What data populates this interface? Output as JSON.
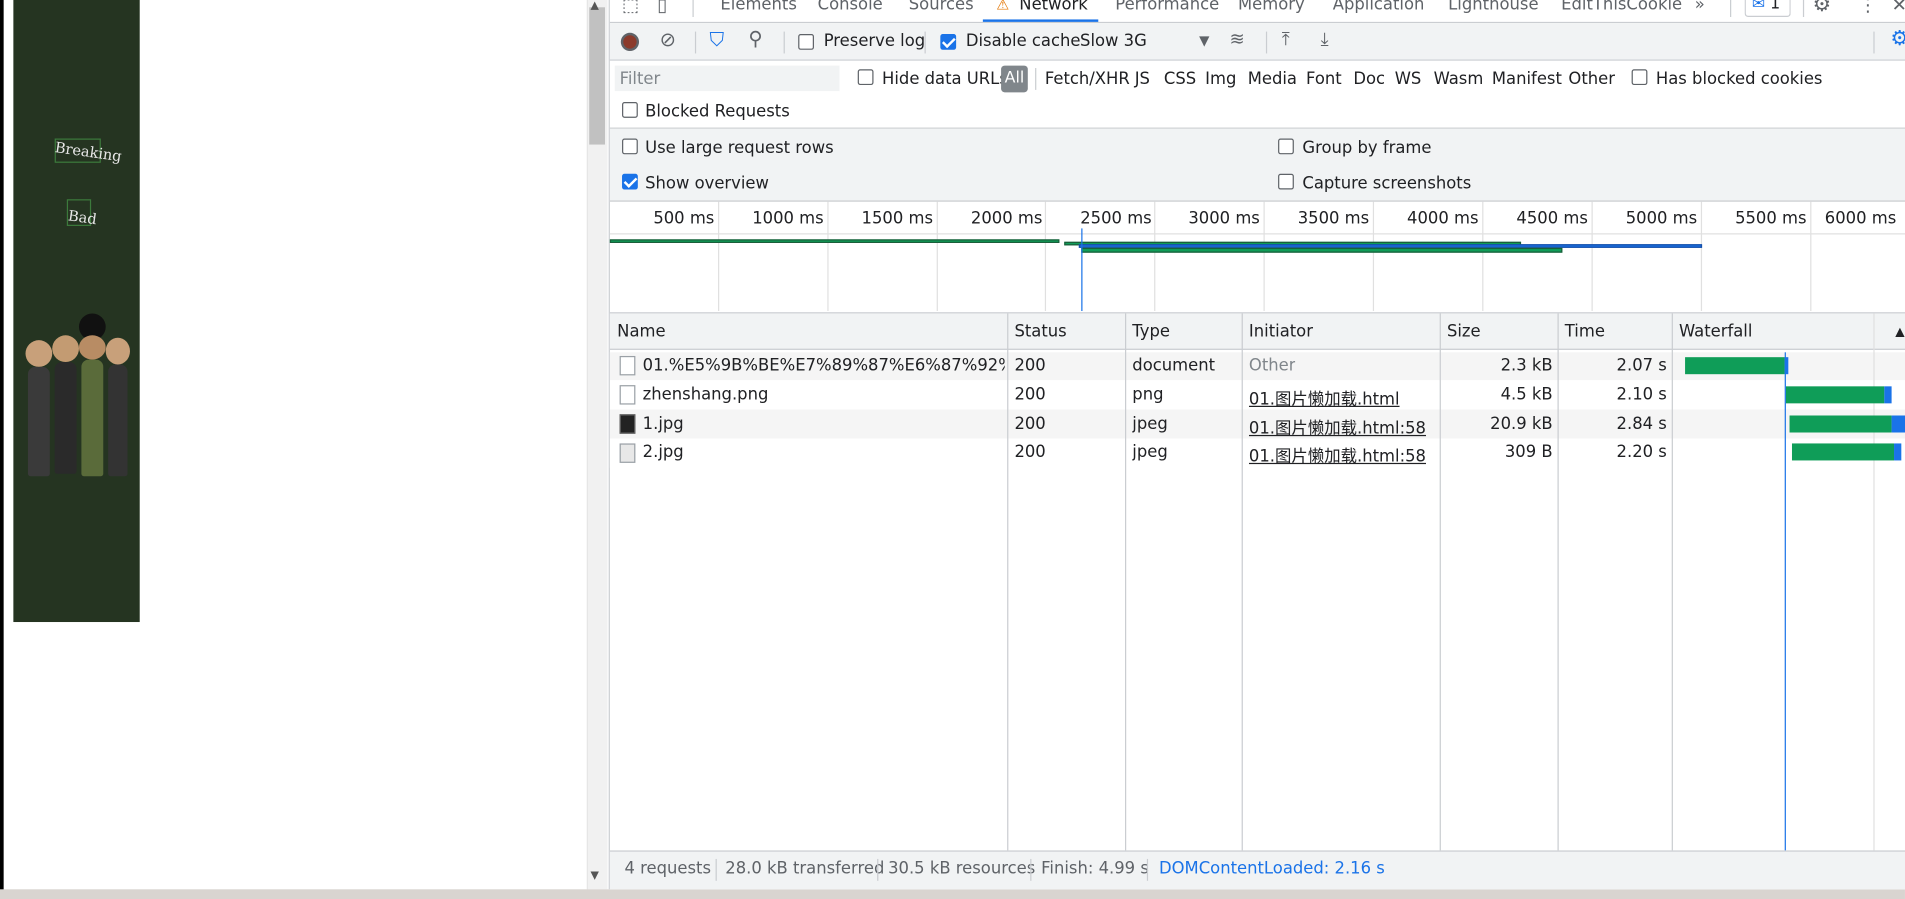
{
  "tabs": [
    "Elements",
    "Console",
    "Sources",
    "Network",
    "Performance",
    "Memory",
    "Application",
    "Lighthouse",
    "EditThisCookie"
  ],
  "issues_badge": "1",
  "toolbar": {
    "preserve_log": "Preserve log",
    "disable_cache": "Disable cache",
    "throttle": "Slow 3G"
  },
  "filter": {
    "placeholder": "Filter",
    "hide_data_urls": "Hide data URLs",
    "types": [
      "All",
      "Fetch/XHR",
      "JS",
      "CSS",
      "Img",
      "Media",
      "Font",
      "Doc",
      "WS",
      "Wasm",
      "Manifest",
      "Other"
    ],
    "has_blocked_cookies": "Has blocked cookies",
    "blocked_requests": "Blocked Requests"
  },
  "settings": {
    "large_rows": "Use large request rows",
    "group_by_frame": "Group by frame",
    "show_overview": "Show overview",
    "capture_screenshots": "Capture screenshots"
  },
  "overview_ticks": [
    "500 ms",
    "1000 ms",
    "1500 ms",
    "2000 ms",
    "2500 ms",
    "3000 ms",
    "3500 ms",
    "4000 ms",
    "4500 ms",
    "5000 ms",
    "5500 ms",
    "6000 ms"
  ],
  "columns": [
    "Name",
    "Status",
    "Type",
    "Initiator",
    "Size",
    "Time",
    "Waterfall"
  ],
  "rows": [
    {
      "name": "01.%E5%9B%BE%E7%89%87%E6%87%92%E5%...",
      "status": "200",
      "type": "document",
      "initiator": "Other",
      "size": "2.3 kB",
      "time": "2.07 s"
    },
    {
      "name": "zhenshang.png",
      "status": "200",
      "type": "png",
      "initiator": "01.图片懒加载.html",
      "size": "4.5 kB",
      "time": "2.10 s"
    },
    {
      "name": "1.jpg",
      "status": "200",
      "type": "jpeg",
      "initiator": "01.图片懒加载.html:58",
      "size": "20.9 kB",
      "time": "2.84 s"
    },
    {
      "name": "2.jpg",
      "status": "200",
      "type": "jpeg",
      "initiator": "01.图片懒加载.html:58",
      "size": "309 B",
      "time": "2.20 s"
    }
  ],
  "summary": {
    "requests": "4 requests",
    "transferred": "28.0 kB transferred",
    "resources": "30.5 kB resources",
    "finish": "Finish: 4.99 s",
    "dcl": "DOMContentLoaded: 2.16 s"
  },
  "poster_text": [
    "Breaking",
    "Bad"
  ],
  "colors": {
    "accent": "#1a73e8",
    "waiting": "#0f9d58",
    "download": "#1a73e8",
    "poster_bg": "#253421"
  }
}
